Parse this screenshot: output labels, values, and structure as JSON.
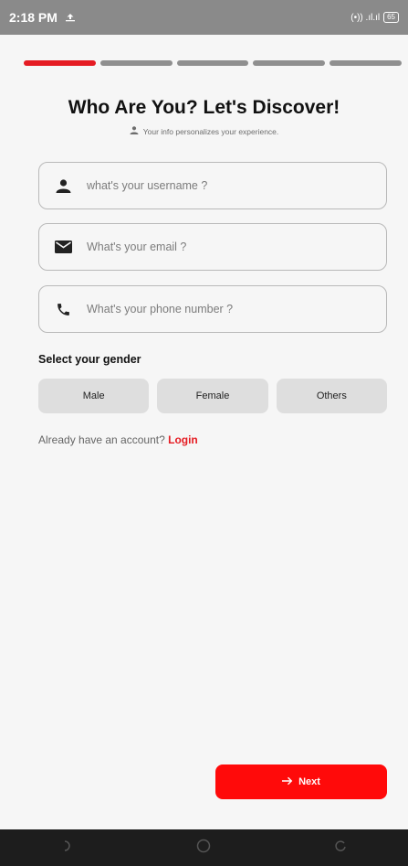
{
  "status_bar": {
    "time": "2:18 PM",
    "signal_text": "(•)) .ıl.ıl",
    "battery": "65"
  },
  "progress": {
    "total_steps": 5,
    "current_step": 1,
    "active_color": "#e51c23",
    "inactive_color": "#8f8f8f"
  },
  "header": {
    "title": "Who Are You? Let's Discover!",
    "subtitle": "Your info personalizes your experience."
  },
  "form": {
    "username": {
      "placeholder": "what's your username ?",
      "value": "",
      "icon": "person-icon"
    },
    "email": {
      "placeholder": "What's your email ?",
      "value": "",
      "icon": "mail-icon"
    },
    "phone": {
      "placeholder": "What's your phone number ?",
      "value": "",
      "icon": "phone-icon"
    }
  },
  "gender": {
    "label": "Select your gender",
    "options": [
      "Male",
      "Female",
      "Others"
    ]
  },
  "login_prompt": {
    "text": "Already have an account?",
    "link": "Login"
  },
  "next_button": {
    "label": "Next",
    "color": "#ff0a0a"
  }
}
